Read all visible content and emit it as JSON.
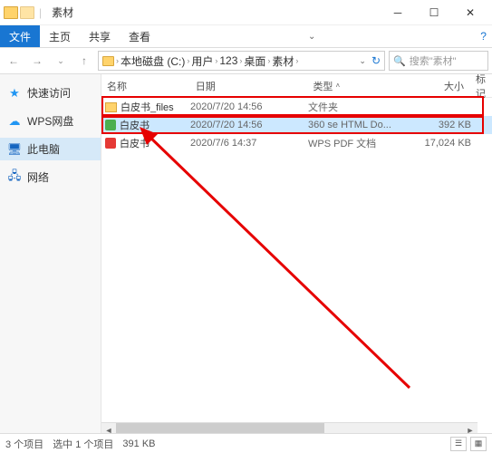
{
  "titlebar": {
    "title": "素材"
  },
  "menubar": {
    "file": "文件",
    "items": [
      "主页",
      "共享",
      "查看"
    ]
  },
  "addressbar": {
    "segments": [
      "本地磁盘 (C:)",
      "用户",
      "123",
      "桌面",
      "素材"
    ]
  },
  "search": {
    "placeholder": "搜索\"素材\""
  },
  "sidebar": {
    "items": [
      {
        "label": "快速访问",
        "icon": "star"
      },
      {
        "label": "WPS网盘",
        "icon": "cloud"
      },
      {
        "label": "此电脑",
        "icon": "pc"
      },
      {
        "label": "网络",
        "icon": "net"
      }
    ]
  },
  "columns": {
    "name": "名称",
    "date": "日期",
    "type": "类型",
    "size": "大小",
    "mark": "标记"
  },
  "files": [
    {
      "name": "白皮书_files",
      "date": "2020/7/20 14:56",
      "type": "文件夹",
      "size": ""
    },
    {
      "name": "白皮书",
      "date": "2020/7/20 14:56",
      "type": "360 se HTML Do...",
      "size": "392 KB"
    },
    {
      "name": "白皮书",
      "date": "2020/7/6 14:37",
      "type": "WPS PDF 文档",
      "size": "17,024 KB"
    }
  ],
  "statusbar": {
    "count": "3 个项目",
    "selection": "选中 1 个项目",
    "selsize": "391 KB"
  }
}
